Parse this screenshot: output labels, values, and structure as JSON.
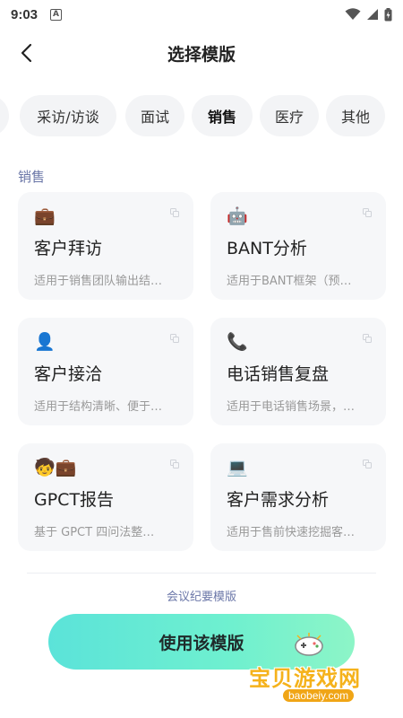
{
  "status_bar": {
    "time": "9:03",
    "app_icon_letter": "A"
  },
  "header": {
    "title": "选择模版"
  },
  "tabs": [
    {
      "label": "采访/访谈"
    },
    {
      "label": "面试"
    },
    {
      "label": "销售"
    },
    {
      "label": "医疗"
    },
    {
      "label": "其他"
    }
  ],
  "active_tab": "销售",
  "section": {
    "title": "销售"
  },
  "cards": [
    {
      "emoji": "💼",
      "title": "客户拜访",
      "desc": "适用于销售团队输出结…"
    },
    {
      "emoji": "🤖",
      "title": "BANT分析",
      "desc": "适用于BANT框架（预…"
    },
    {
      "emoji": "👤",
      "title": "客户接洽",
      "desc": "适用于结构清晰、便于…"
    },
    {
      "emoji": "📞",
      "title": "电话销售复盘",
      "desc": "适用于电话销售场景，…"
    },
    {
      "emoji": "🧒💼",
      "title": "GPCT报告",
      "desc": "基于 GPCT 四问法整…"
    },
    {
      "emoji": "💻",
      "title": "客户需求分析",
      "desc": "适用于售前快速挖掘客…"
    }
  ],
  "footer": {
    "label": "会议纪要模版"
  },
  "use_button": {
    "label": "使用该模版"
  },
  "watermark": {
    "text": "宝贝游戏网",
    "url": "baobeiy.com"
  },
  "colors": {
    "accent_gradient_start": "#5be3d9",
    "accent_gradient_end": "#8df5c7",
    "section_label": "#6b77a8",
    "watermark": "#f5b21b"
  }
}
